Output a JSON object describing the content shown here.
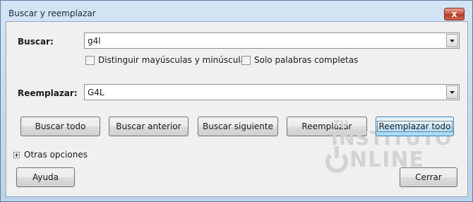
{
  "window": {
    "title": "Buscar y reemplazar",
    "close_glyph": "x"
  },
  "search": {
    "label": "Buscar:",
    "value": "g4l"
  },
  "options": {
    "match_case": {
      "label": "Distinguir mayúsculas y minúsculas",
      "checked": false
    },
    "whole_words": {
      "label": "Solo palabras completas",
      "checked": false
    }
  },
  "replace": {
    "label": "Reemplazar:",
    "value": "G4L"
  },
  "buttons": {
    "find_all": "Buscar todo",
    "find_prev": "Buscar anterior",
    "find_next": "Buscar siguiente",
    "replace": "Reemplazar",
    "replace_all": "Reemplazar todo",
    "help": "Ayuda",
    "close": "Cerrar"
  },
  "more_options": {
    "label": "Otras opciones"
  },
  "watermark": {
    "line1": "TU",
    "line2": "INSTITUTO",
    "line3": "NLINE"
  },
  "colors": {
    "title_bar": "#c9dcf0",
    "close_button": "#c9533f",
    "focus_button": "#3c7fb1"
  }
}
